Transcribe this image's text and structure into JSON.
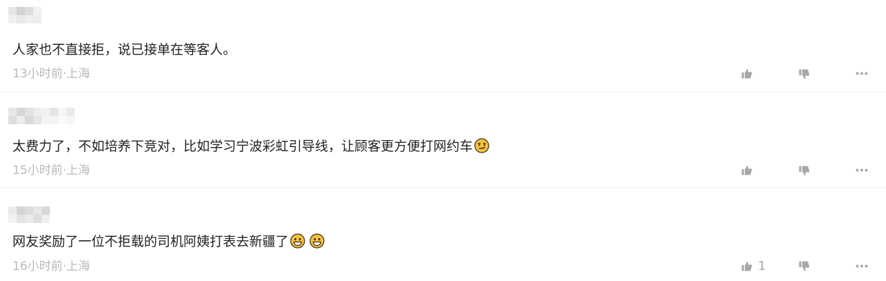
{
  "comments": [
    {
      "text": "人家也不直接拒，说已接单在等客人。",
      "meta": "13小时前·上海",
      "likes": ""
    },
    {
      "text": "太费力了，不如培养下竞对，比如学习宁波彩虹引导线，让顾客更方便打网约车",
      "meta": "15小时前·上海",
      "likes": "",
      "emojis": [
        "smirk-emoji"
      ]
    },
    {
      "text": "网友奖励了一位不拒载的司机阿姨打表去新疆了",
      "meta": "16小时前·上海",
      "likes": "1",
      "emojis": [
        "grin-emoji",
        "grin-emoji"
      ]
    }
  ],
  "icons": {
    "like": "thumbs-up-icon",
    "dislike": "thumbs-down-icon",
    "more": "more-dots-icon"
  },
  "colors": {
    "text": "#222222",
    "meta": "#b8b8b8",
    "icon": "#a8a8a8",
    "divider": "#f0f0f0",
    "emoji": "#f5c242"
  }
}
